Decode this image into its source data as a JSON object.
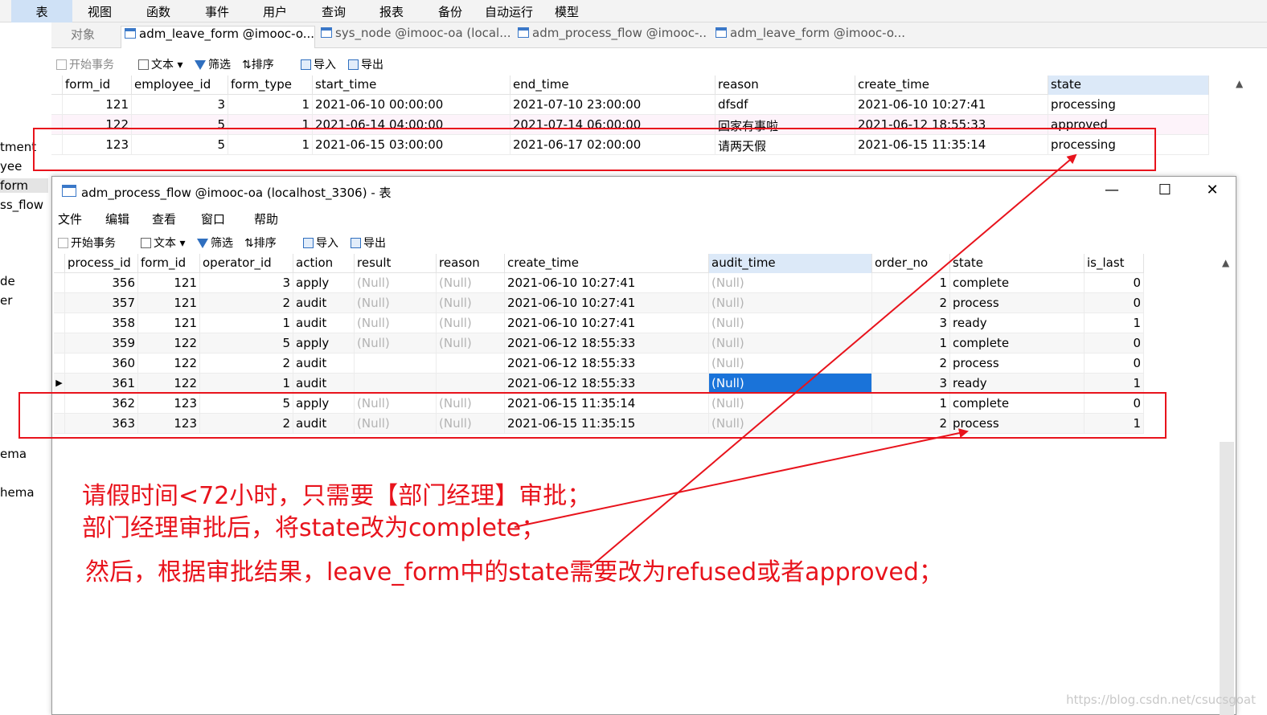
{
  "menubar": {
    "items": [
      "表",
      "视图",
      "函数",
      "事件",
      "用户",
      "查询",
      "报表",
      "备份",
      "自动运行",
      "模型"
    ]
  },
  "left_panel": {
    "items": [
      "tment",
      "yee",
      "form",
      "ss_flow",
      "de",
      "er",
      "ema",
      "hema"
    ]
  },
  "tabs": {
    "objects": "对象",
    "items": [
      "adm_leave_form @imooc-o...",
      "sys_node @imooc-oa (local...",
      "adm_process_flow @imooc-...",
      "adm_leave_form @imooc-o..."
    ]
  },
  "toolbar": {
    "begin_tx": "开始事务",
    "text": "文本",
    "filter": "筛选",
    "sort": "排序",
    "import": "导入",
    "export": "导出"
  },
  "leave_form": {
    "columns": [
      "form_id",
      "employee_id",
      "form_type",
      "start_time",
      "end_time",
      "reason",
      "create_time",
      "state"
    ],
    "rows": [
      [
        "121",
        "3",
        "1",
        "2021-06-10 00:00:00",
        "2021-07-10 23:00:00",
        "dfsdf",
        "2021-06-10 10:27:41",
        "processing"
      ],
      [
        "122",
        "5",
        "1",
        "2021-06-14 04:00:00",
        "2021-07-14 06:00:00",
        "回家有事啦",
        "2021-06-12 18:55:33",
        "approved"
      ],
      [
        "123",
        "5",
        "1",
        "2021-06-15 03:00:00",
        "2021-06-17 02:00:00",
        "请两天假",
        "2021-06-15 11:35:14",
        "processing"
      ]
    ]
  },
  "process_window": {
    "title": "adm_process_flow @imooc-oa (localhost_3306) - 表",
    "controls": {
      "minimize": "—",
      "maximize": "☐",
      "close": "✕"
    },
    "menu": [
      "文件",
      "编辑",
      "查看",
      "窗口",
      "帮助"
    ]
  },
  "process_flow": {
    "columns": [
      "process_id",
      "form_id",
      "operator_id",
      "action",
      "result",
      "reason",
      "create_time",
      "audit_time",
      "order_no",
      "state",
      "is_last"
    ],
    "rows": [
      [
        "356",
        "121",
        "3",
        "apply",
        "(Null)",
        "(Null)",
        "2021-06-10 10:27:41",
        "(Null)",
        "1",
        "complete",
        "0"
      ],
      [
        "357",
        "121",
        "2",
        "audit",
        "(Null)",
        "(Null)",
        "2021-06-10 10:27:41",
        "(Null)",
        "2",
        "process",
        "0"
      ],
      [
        "358",
        "121",
        "1",
        "audit",
        "(Null)",
        "(Null)",
        "2021-06-10 10:27:41",
        "(Null)",
        "3",
        "ready",
        "1"
      ],
      [
        "359",
        "122",
        "5",
        "apply",
        "(Null)",
        "(Null)",
        "2021-06-12 18:55:33",
        "(Null)",
        "1",
        "complete",
        "0"
      ],
      [
        "360",
        "122",
        "2",
        "audit",
        "",
        "",
        "2021-06-12 18:55:33",
        "(Null)",
        "2",
        "process",
        "0"
      ],
      [
        "361",
        "122",
        "1",
        "audit",
        "",
        "",
        "2021-06-12 18:55:33",
        "(Null)",
        "3",
        "ready",
        "1"
      ],
      [
        "362",
        "123",
        "5",
        "apply",
        "(Null)",
        "(Null)",
        "2021-06-15 11:35:14",
        "(Null)",
        "1",
        "complete",
        "0"
      ],
      [
        "363",
        "123",
        "2",
        "audit",
        "(Null)",
        "(Null)",
        "2021-06-15 11:35:15",
        "(Null)",
        "2",
        "process",
        "1"
      ]
    ]
  },
  "annotations": {
    "line1": "请假时间<72小时，只需要【部门经理】审批；",
    "line2": "部门经理审批后，将state改为complete；",
    "line3": "然后，根据审批结果，leave_form中的state需要改为refused或者approved；"
  },
  "watermark": "https://blog.csdn.net/csucsgoat",
  "colors": {
    "annotation_red": "#e8131c",
    "selection_blue": "#1a73d9",
    "header_highlight": "#dce9f8"
  }
}
